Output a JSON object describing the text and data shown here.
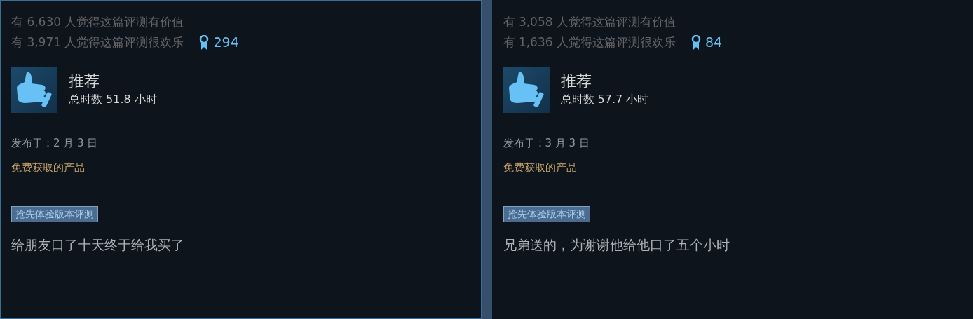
{
  "reviews": [
    {
      "highlighted": true,
      "helpful": "有 6,630 人觉得这篇评测有价值",
      "funny": "有 3,971 人觉得这篇评测很欢乐",
      "awards": "294",
      "verdict": "推荐",
      "recommended": true,
      "hours": "总时数 51.8 小时",
      "posted": "发布于：2 月 3 日",
      "free_product": "免费获取的产品",
      "tag": "抢先体验版本评测",
      "text": "给朋友口了十天终于给我买了"
    },
    {
      "highlighted": false,
      "helpful": "有 3,058 人觉得这篇评测有价值",
      "funny": "有 1,636 人觉得这篇评测很欢乐",
      "awards": "84",
      "verdict": "推荐",
      "recommended": true,
      "hours": "总时数 57.7 小时",
      "posted": "发布于：3 月 3 日",
      "free_product": "免费获取的产品",
      "tag": "抢先体验版本评测",
      "text": "兄弟送的，为谢谢他给他口了五个小时"
    }
  ]
}
